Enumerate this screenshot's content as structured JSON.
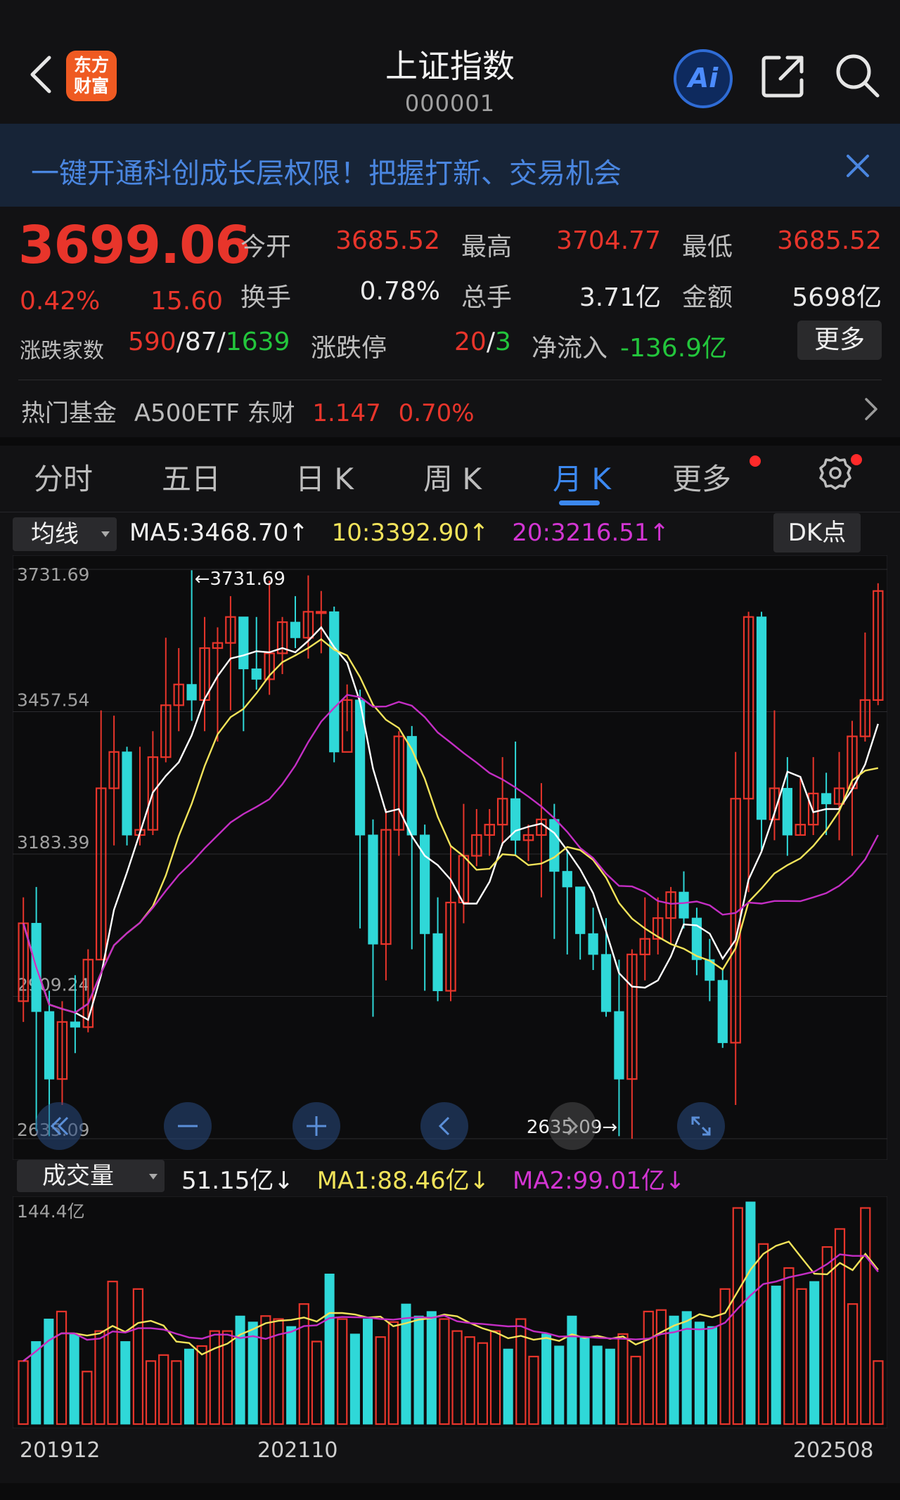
{
  "header": {
    "logo_text_1": "东方",
    "logo_text_2": "财富",
    "title": "上证指数",
    "code": "000001",
    "ai_label": "Ai",
    "icons": [
      "back-arrow-icon",
      "ai-icon",
      "share-icon",
      "search-icon"
    ]
  },
  "banner": {
    "text": "一键开通科创成长层权限！把握打新、交易机会",
    "icon": "close-icon"
  },
  "quote": {
    "price": "3699.06",
    "change_pct": "0.42%",
    "change_val": "15.60",
    "open_label": "今开",
    "open": "3685.52",
    "high_label": "最高",
    "high": "3704.77",
    "low_label": "最低",
    "low": "3685.52",
    "turnover_label": "换手",
    "turnover": "0.78%",
    "volume_label": "总手",
    "volume": "3.71亿",
    "amount_label": "金额",
    "amount": "5698亿",
    "adv_dec_label": "涨跌家数",
    "adv": "590",
    "flat": "87",
    "dec": "1639",
    "limit_label": "涨跌停",
    "limit_up": "20",
    "limit_down": "3",
    "netflow_label": "净流入",
    "netflow": "-136.9亿",
    "more_label": "更多",
    "sep": "/"
  },
  "fund": {
    "label": "热门基金",
    "name": "A500ETF 东财",
    "price": "1.147",
    "pct": "0.70%"
  },
  "tabs": [
    "分时",
    "五日",
    "日 K",
    "周 K",
    "月 K",
    "更多"
  ],
  "active_tab": "月 K",
  "ma_bar": {
    "select": "均线",
    "ma5": "MA5:3468.70↑",
    "ma10": "10:3392.90↑",
    "ma20": "20:3216.51↑",
    "dk": "DK点"
  },
  "chart_data": {
    "type": "candlestick",
    "period": "monthly",
    "y_ticks": [
      "3731.69",
      "3457.54",
      "3183.39",
      "2909.24",
      "2635.09"
    ],
    "ylim": [
      2635.09,
      3731.69
    ],
    "max_label": "←3731.69",
    "min_label": "2635.09→",
    "x_labels": [
      "201912",
      "202110",
      "202508"
    ],
    "colors": {
      "up": "#e8352b",
      "down": "#2fd8d8",
      "ma5": "#ffffff",
      "ma10": "#f2e35a",
      "ma20": "#c42ec4"
    },
    "candles": [
      [
        2900,
        3050,
        3100,
        2860
      ],
      [
        3050,
        2880,
        3120,
        2650
      ],
      [
        2880,
        2750,
        2920,
        2640
      ],
      [
        2750,
        2860,
        2900,
        2700
      ],
      [
        2860,
        2850,
        2950,
        2800
      ],
      [
        2850,
        2980,
        3000,
        2840
      ],
      [
        2980,
        3310,
        3460,
        2980
      ],
      [
        3310,
        3380,
        3450,
        3200
      ],
      [
        3380,
        3220,
        3390,
        3200
      ],
      [
        3220,
        3230,
        3390,
        3200
      ],
      [
        3230,
        3370,
        3420,
        3220
      ],
      [
        3370,
        3470,
        3600,
        3360
      ],
      [
        3470,
        3510,
        3580,
        3420
      ],
      [
        3510,
        3480,
        3730,
        3440
      ],
      [
        3480,
        3580,
        3640,
        3420
      ],
      [
        3580,
        3590,
        3620,
        3400
      ],
      [
        3590,
        3640,
        3680,
        3460
      ],
      [
        3640,
        3540,
        3620,
        3420
      ],
      [
        3540,
        3520,
        3640,
        3500
      ],
      [
        3520,
        3570,
        3710,
        3490
      ],
      [
        3570,
        3630,
        3640,
        3530
      ],
      [
        3630,
        3600,
        3680,
        3580
      ],
      [
        3600,
        3650,
        3720,
        3560
      ],
      [
        3650,
        3650,
        3690,
        3570
      ],
      [
        3650,
        3380,
        3660,
        3360
      ],
      [
        3380,
        3480,
        3510,
        3420
      ],
      [
        3480,
        3220,
        3500,
        3040
      ],
      [
        3220,
        3010,
        3250,
        2870
      ],
      [
        3010,
        3230,
        3270,
        2940
      ],
      [
        3230,
        3410,
        3420,
        3180
      ],
      [
        3410,
        3220,
        3430,
        3000
      ],
      [
        3220,
        3030,
        3240,
        2920
      ],
      [
        3030,
        2920,
        3100,
        2900
      ],
      [
        2920,
        3090,
        3200,
        2900
      ],
      [
        3090,
        3180,
        3280,
        3050
      ],
      [
        3180,
        3220,
        3270,
        3160
      ],
      [
        3220,
        3240,
        3270,
        3180
      ],
      [
        3240,
        3290,
        3370,
        3200
      ],
      [
        3290,
        3210,
        3400,
        3180
      ],
      [
        3210,
        3220,
        3240,
        3170
      ],
      [
        3220,
        3250,
        3320,
        3100
      ],
      [
        3250,
        3150,
        3280,
        3020
      ],
      [
        3150,
        3120,
        3190,
        2990
      ],
      [
        3120,
        3030,
        3120,
        2980
      ],
      [
        3030,
        2990,
        3080,
        2960
      ],
      [
        2990,
        2880,
        3060,
        2870
      ],
      [
        2880,
        2750,
        2980,
        2640
      ],
      [
        2750,
        2990,
        3000,
        2635
      ],
      [
        2990,
        3020,
        3100,
        2940
      ],
      [
        3020,
        3060,
        3100,
        2990
      ],
      [
        3060,
        3110,
        3120,
        3010
      ],
      [
        3110,
        3060,
        3150,
        3040
      ],
      [
        3060,
        2980,
        3080,
        2950
      ],
      [
        2980,
        2940,
        3020,
        2900
      ],
      [
        2940,
        2820,
        2960,
        2810
      ],
      [
        2820,
        3290,
        3380,
        2700
      ],
      [
        3290,
        3640,
        3650,
        3110
      ],
      [
        3640,
        3250,
        3650,
        3190
      ],
      [
        3250,
        3310,
        3460,
        3210
      ],
      [
        3310,
        3220,
        3370,
        3180
      ],
      [
        3220,
        3240,
        3330,
        3220
      ],
      [
        3240,
        3300,
        3370,
        3220
      ],
      [
        3300,
        3280,
        3340,
        3220
      ],
      [
        3280,
        3310,
        3380,
        3210
      ],
      [
        3310,
        3410,
        3440,
        3180
      ],
      [
        3410,
        3480,
        3610,
        3400
      ],
      [
        3480,
        3690,
        3705,
        3470
      ]
    ]
  },
  "volume_bar": {
    "select": "成交量",
    "value": "51.15亿↓",
    "ma1": "MA1:88.46亿↓",
    "ma2": "MA2:99.01亿↓",
    "max_label": "144.4亿"
  },
  "volume_data": [
    42,
    55,
    70,
    75,
    60,
    35,
    62,
    95,
    55,
    90,
    42,
    46,
    42,
    50,
    52,
    62,
    62,
    72,
    68,
    72,
    70,
    65,
    80,
    55,
    100,
    70,
    60,
    70,
    58,
    68,
    80,
    72,
    75,
    70,
    62,
    58,
    54,
    62,
    50,
    70,
    45,
    60,
    52,
    72,
    58,
    52,
    50,
    60,
    45,
    75,
    76,
    72,
    75,
    68,
    65,
    90,
    144,
    148,
    120,
    92,
    104,
    90,
    95,
    118,
    130,
    80,
    144,
    42
  ],
  "colors": {
    "accent": "#3c88f0",
    "up": "#e8352b",
    "down": "#2fd8d8",
    "banner_bg": "#172437"
  }
}
